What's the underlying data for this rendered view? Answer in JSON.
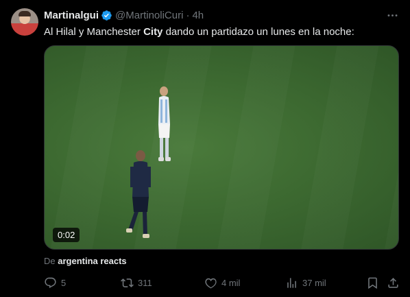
{
  "tweet": {
    "display_name": "Martinalgui",
    "handle": "@MartinoliCuri",
    "separator": "·",
    "time": "4h",
    "text_before": "Al Hilal y Manchester ",
    "text_bold": "City",
    "text_after": " dando un partidazo un lunes en la noche:"
  },
  "media": {
    "duration": "0:02"
  },
  "source": {
    "prefix": "De ",
    "name": "argentina reacts"
  },
  "actions": {
    "replies": "5",
    "retweets": "311",
    "likes": "4 mil",
    "views": "37 mil"
  },
  "colors": {
    "background": "#000000",
    "text_primary": "#e7e9ea",
    "text_secondary": "#71767b",
    "verified": "#1d9bf0"
  },
  "icons": [
    "more-icon",
    "verified-icon",
    "reply-icon",
    "retweet-icon",
    "like-icon",
    "views-icon",
    "bookmark-icon",
    "share-icon"
  ]
}
